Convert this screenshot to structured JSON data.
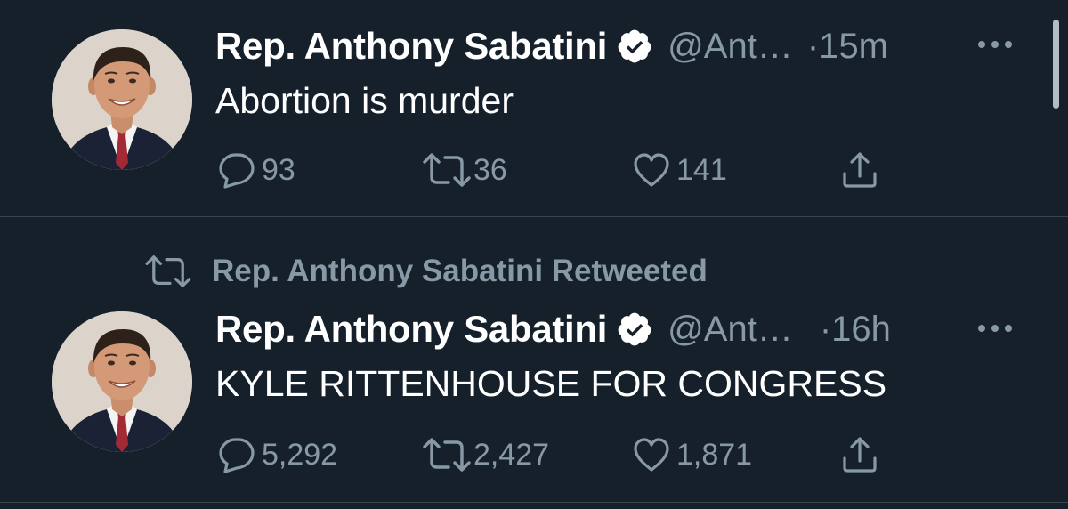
{
  "tweets": [
    {
      "display_name": "Rep. Anthony Sabatini",
      "handle": "@Ant…",
      "separator": "·",
      "time": "15m",
      "text": "Abortion is murder",
      "replies": "93",
      "retweets": "36",
      "likes": "141"
    },
    {
      "retweeted_by": "Rep. Anthony Sabatini Retweeted",
      "display_name": "Rep. Anthony Sabatini",
      "handle": "@Ant…",
      "separator": "·",
      "time": "16h",
      "text": "KYLE RITTENHOUSE FOR CONGRESS",
      "replies": "5,292",
      "retweets": "2,427",
      "likes": "1,871"
    }
  ],
  "icons": {
    "verified": "verified-badge-icon",
    "more": "more-dots-icon",
    "reply": "reply-bubble-icon",
    "retweet": "retweet-arrows-icon",
    "like": "heart-icon",
    "share": "share-upload-icon"
  },
  "colors": {
    "background": "#15202b",
    "text_primary": "#ffffff",
    "text_secondary": "#8899a6",
    "divider": "#38444d"
  }
}
